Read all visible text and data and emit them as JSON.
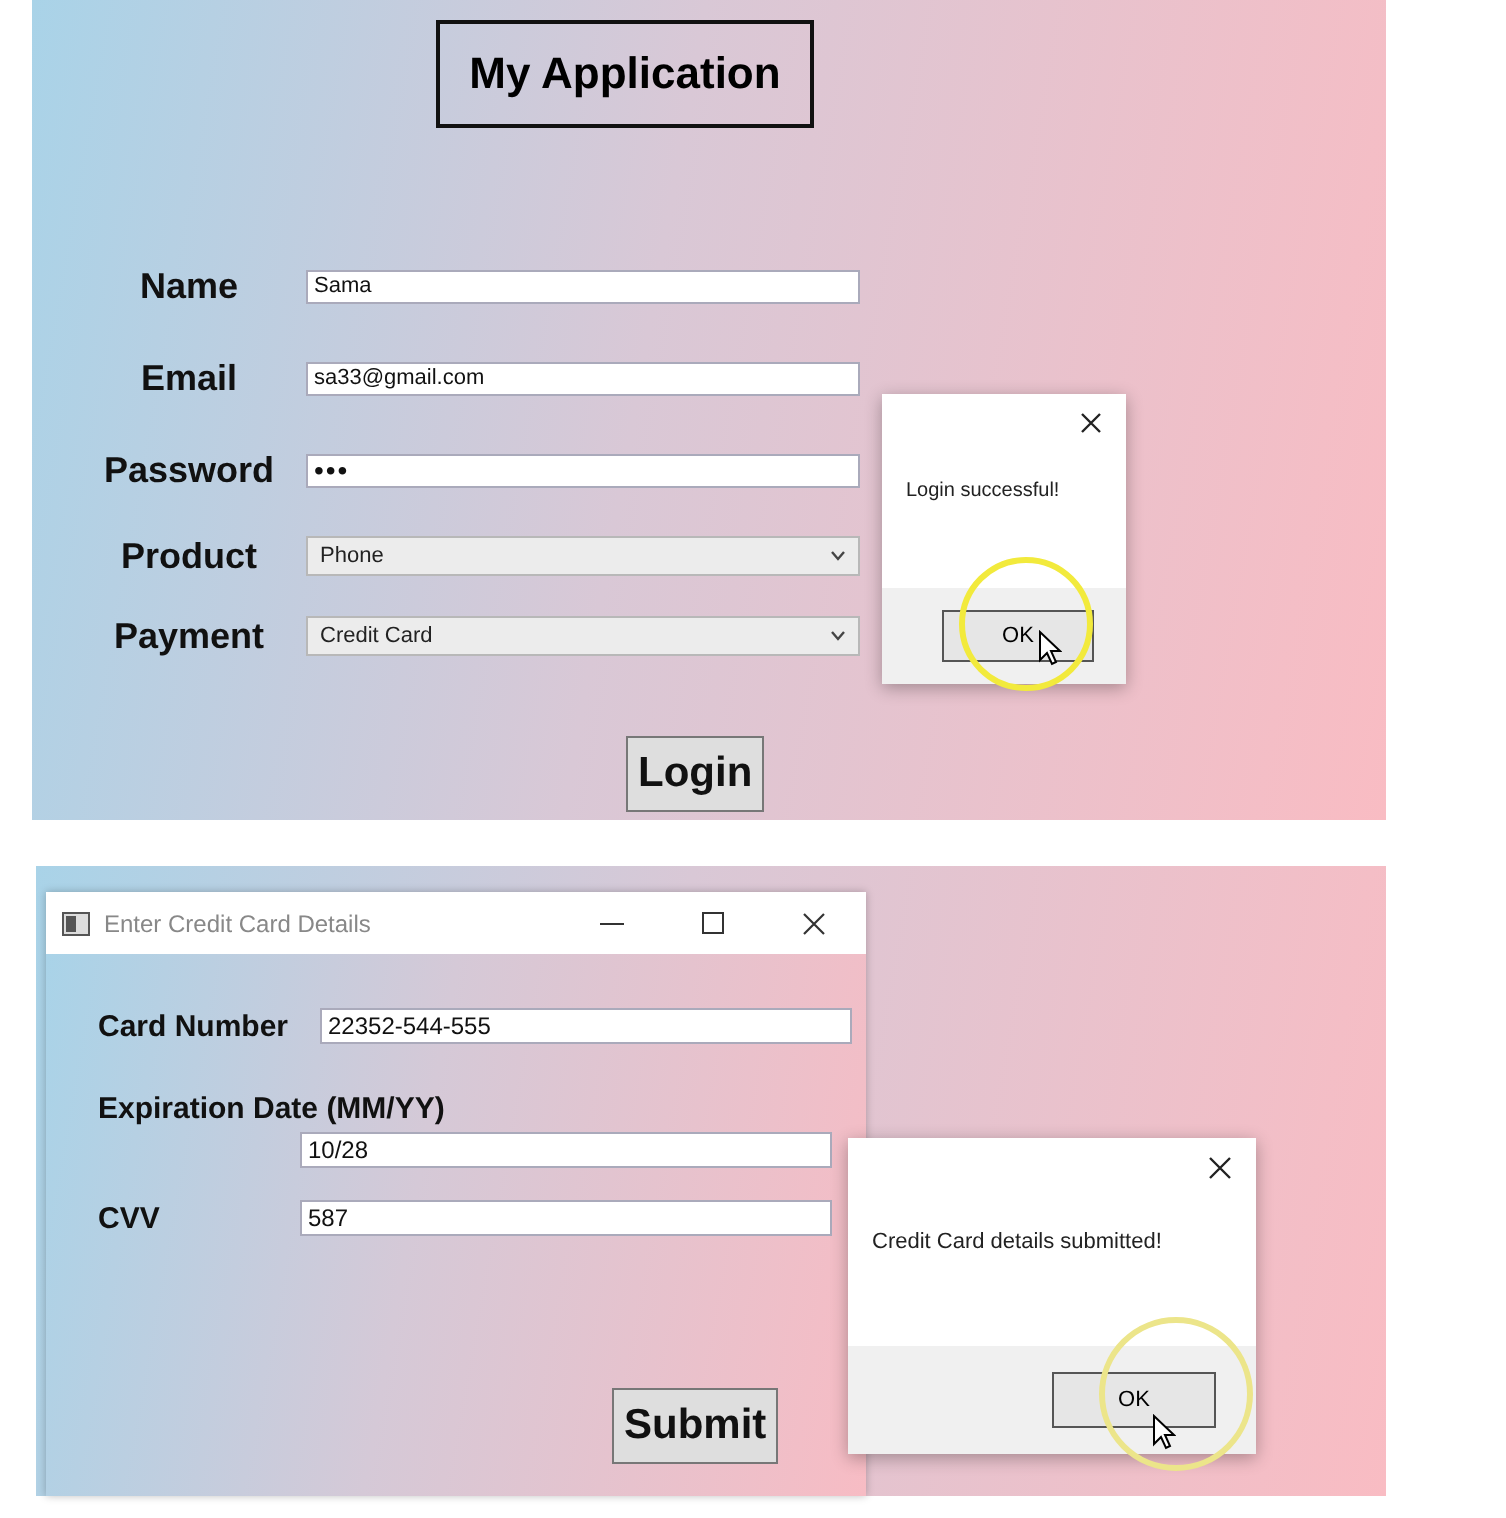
{
  "login_form": {
    "title": "My Application",
    "fields": [
      {
        "label": "Name",
        "kind": "text",
        "value": "Sama"
      },
      {
        "label": "Email",
        "kind": "text",
        "value": "sa33@gmail.com"
      },
      {
        "label": "Password",
        "kind": "password",
        "value": "•••"
      },
      {
        "label": "Product",
        "kind": "dropdown",
        "value": "Phone"
      },
      {
        "label": "Payment",
        "kind": "dropdown",
        "value": "Credit Card"
      }
    ],
    "button": "Login",
    "dialog": {
      "message": "Login successful!",
      "button": "OK"
    }
  },
  "card_window": {
    "title": "Enter Credit Card Details",
    "fields": [
      {
        "label": "Card Number",
        "kind": "inline",
        "value": "22352-544-555"
      },
      {
        "label": "Expiration Date (MM/YY)",
        "kind": "stacked",
        "value": "10/28"
      },
      {
        "label": "CVV",
        "kind": "inline",
        "value": "587"
      }
    ],
    "button": "Submit",
    "dialog": {
      "message": "Credit Card details submitted!",
      "button": "OK"
    }
  }
}
